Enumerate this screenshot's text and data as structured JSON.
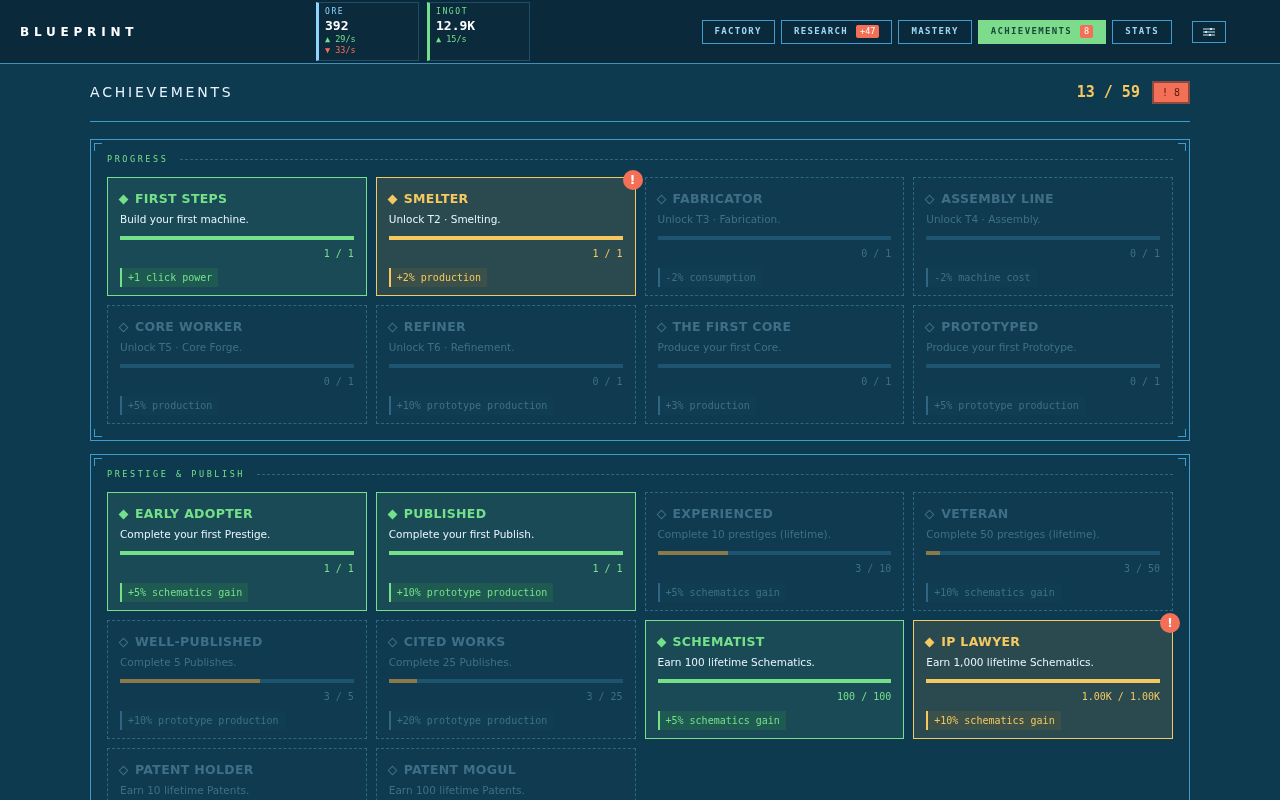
{
  "brand": "BLUEPRINT",
  "resources": [
    {
      "label": "ORE",
      "value": "392",
      "color": "#8fd3ff",
      "rates": [
        {
          "kind": "up",
          "text": "▲ 29/s"
        },
        {
          "kind": "down",
          "text": "▼ 33/s"
        }
      ]
    },
    {
      "label": "INGOT",
      "value": "12.9K",
      "color": "#74e08a",
      "rates": [
        {
          "kind": "up",
          "text": "▲ 15/s"
        }
      ]
    }
  ],
  "tabs": [
    {
      "label": "FACTORY",
      "selected": false
    },
    {
      "label": "RESEARCH",
      "badge": "+47",
      "selected": false
    },
    {
      "label": "MASTERY",
      "selected": false
    },
    {
      "label": "ACHIEVEMENTS",
      "badge": "8",
      "selected": true
    },
    {
      "label": "STATS",
      "selected": false
    }
  ],
  "page": {
    "title": "ACHIEVEMENTS",
    "count": "13 / 59",
    "alert_badge": "! 8"
  },
  "sections": [
    {
      "title": "PROGRESS",
      "cards": [
        {
          "kind": "claimed",
          "title": "FIRST STEPS",
          "description": "Build your first machine.",
          "progress": "1 / 1",
          "reward": "+1 click power"
        },
        {
          "kind": "new",
          "alert": "!",
          "title": "SMELTER",
          "description": "Unlock T2 · Smelting.",
          "progress": "1 / 1",
          "reward": "+2% production"
        },
        {
          "kind": "locked",
          "title": "FABRICATOR",
          "description": "Unlock T3 · Fabrication.",
          "progress": "0 / 1",
          "reward": "-2% consumption"
        },
        {
          "kind": "locked",
          "title": "ASSEMBLY LINE",
          "description": "Unlock T4 · Assembly.",
          "progress": "0 / 1",
          "reward": "-2% machine cost"
        },
        {
          "kind": "locked",
          "title": "CORE WORKER",
          "description": "Unlock T5 · Core Forge.",
          "progress": "0 / 1",
          "reward": "+5% production"
        },
        {
          "kind": "locked",
          "title": "REFINER",
          "description": "Unlock T6 · Refinement.",
          "progress": "0 / 1",
          "reward": "+10% prototype production"
        },
        {
          "kind": "locked",
          "title": "THE FIRST CORE",
          "description": "Produce your first Core.",
          "progress": "0 / 1",
          "reward": "+3% production"
        },
        {
          "kind": "locked",
          "title": "PROTOTYPED",
          "description": "Produce your first Prototype.",
          "progress": "0 / 1",
          "reward": "+5% prototype production"
        }
      ]
    },
    {
      "title": "PRESTIGE & PUBLISH",
      "cards": [
        {
          "kind": "claimed",
          "title": "EARLY ADOPTER",
          "description": "Complete your first Prestige.",
          "progress": "1 / 1",
          "reward": "+5% schematics gain"
        },
        {
          "kind": "claimed",
          "title": "PUBLISHED",
          "description": "Complete your first Publish.",
          "progress": "1 / 1",
          "reward": "+10% prototype production"
        },
        {
          "kind": "locked",
          "title": "EXPERIENCED",
          "description": "Complete 10 prestiges (lifetime).",
          "level": 0.3,
          "progress": "3 / 10",
          "reward": "+5% schematics gain"
        },
        {
          "kind": "locked",
          "title": "VETERAN",
          "description": "Complete 50 prestiges (lifetime).",
          "level": 0.06,
          "progress": "3 / 50",
          "reward": "+10% schematics gain"
        },
        {
          "kind": "locked",
          "title": "WELL-PUBLISHED",
          "description": "Complete 5 Publishes.",
          "level": 0.6,
          "progress": "3 / 5",
          "reward": "+10% prototype production"
        },
        {
          "kind": "locked",
          "title": "CITED WORKS",
          "description": "Complete 25 Publishes.",
          "level": 0.12,
          "progress": "3 / 25",
          "reward": "+20% prototype production"
        },
        {
          "kind": "claimed",
          "title": "SCHEMATIST",
          "description": "Earn 100 lifetime Schematics.",
          "progress": "100 / 100",
          "reward": "+5% schematics gain"
        },
        {
          "kind": "new",
          "alert": "!",
          "title": "IP LAWYER",
          "description": "Earn 1,000 lifetime Schematics.",
          "progress": "1.00K / 1.00K",
          "reward": "+10% schematics gain"
        },
        {
          "kind": "locked",
          "title": "PATENT HOLDER",
          "description": "Earn 10 lifetime Patents."
        },
        {
          "kind": "locked",
          "title": "PATENT MOGUL",
          "description": "Earn 100 lifetime Patents."
        }
      ]
    }
  ]
}
